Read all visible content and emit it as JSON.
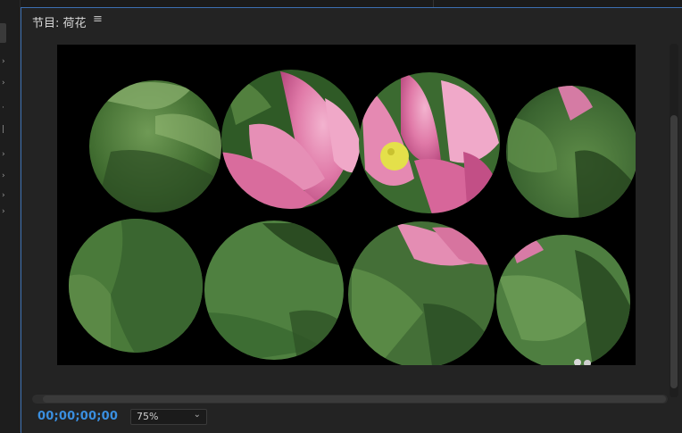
{
  "panel": {
    "title": "节目: 荷花",
    "menu_icon": "hamburger-icon",
    "menu_glyph": "≡"
  },
  "viewer": {
    "description_icon": "video-frame"
  },
  "playback": {
    "timecode": "00;00;00;00",
    "zoom": "75%",
    "zoom_chevron": "⌄"
  },
  "colors": {
    "accent": "#3a8fe0",
    "panel_border": "#3c6fb2",
    "leaf_green": "#4f7d3f",
    "lotus_pink": "#e07aa8"
  }
}
